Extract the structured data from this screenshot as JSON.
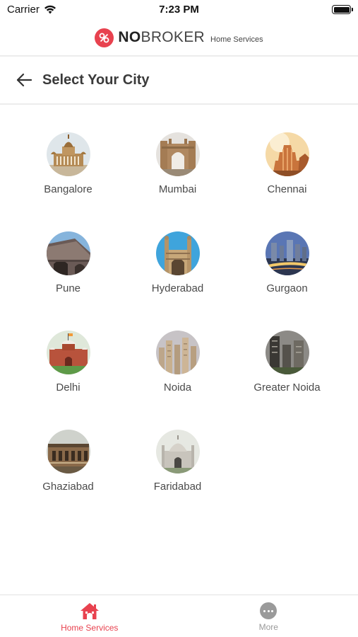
{
  "status_bar": {
    "carrier": "Carrier",
    "time": "7:23 PM"
  },
  "brand": {
    "name_bold": "NO",
    "name_rest": "BROKER",
    "subtitle": "Home Services",
    "color": "#e8424f"
  },
  "header": {
    "title": "Select Your City"
  },
  "cities": [
    {
      "name": "Bangalore",
      "icon": "vidhana-soudha-image"
    },
    {
      "name": "Mumbai",
      "icon": "gateway-of-india-image"
    },
    {
      "name": "Chennai",
      "icon": "temple-image"
    },
    {
      "name": "Pune",
      "icon": "shaniwar-wada-image"
    },
    {
      "name": "Hyderabad",
      "icon": "charminar-image"
    },
    {
      "name": "Gurgaon",
      "icon": "skyline-image"
    },
    {
      "name": "Delhi",
      "icon": "red-fort-image"
    },
    {
      "name": "Noida",
      "icon": "towers-image"
    },
    {
      "name": "Greater Noida",
      "icon": "buildings-image"
    },
    {
      "name": "Ghaziabad",
      "icon": "heritage-building-image"
    },
    {
      "name": "Faridabad",
      "icon": "dome-monument-image"
    }
  ],
  "bottom_nav": {
    "home_services": "Home Services",
    "more": "More",
    "active_color": "#e8424f",
    "inactive_color": "#9a9a9a"
  }
}
